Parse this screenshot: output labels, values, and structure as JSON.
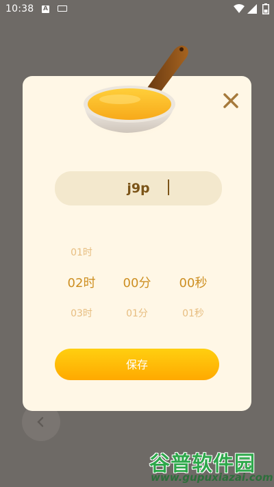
{
  "status_bar": {
    "time": "10:38",
    "a_glyph": "A"
  },
  "dialog": {
    "name_value": "j9p",
    "picker": {
      "hours": [
        "01时",
        "02时",
        "03时"
      ],
      "minutes": [
        "",
        "00分",
        "01分"
      ],
      "seconds": [
        "",
        "00秒",
        "01秒"
      ],
      "selected_index": 1
    },
    "save_label": "保存"
  },
  "watermark": {
    "title": "谷普软件园",
    "url": "www.gupuxiazai.com"
  },
  "colors": {
    "backdrop": "#6e6a66",
    "dialog_bg": "#fff7e6",
    "accent": "#ffb300",
    "picker_selected": "#cd8f22",
    "picker_faint": "#e7bd80"
  }
}
